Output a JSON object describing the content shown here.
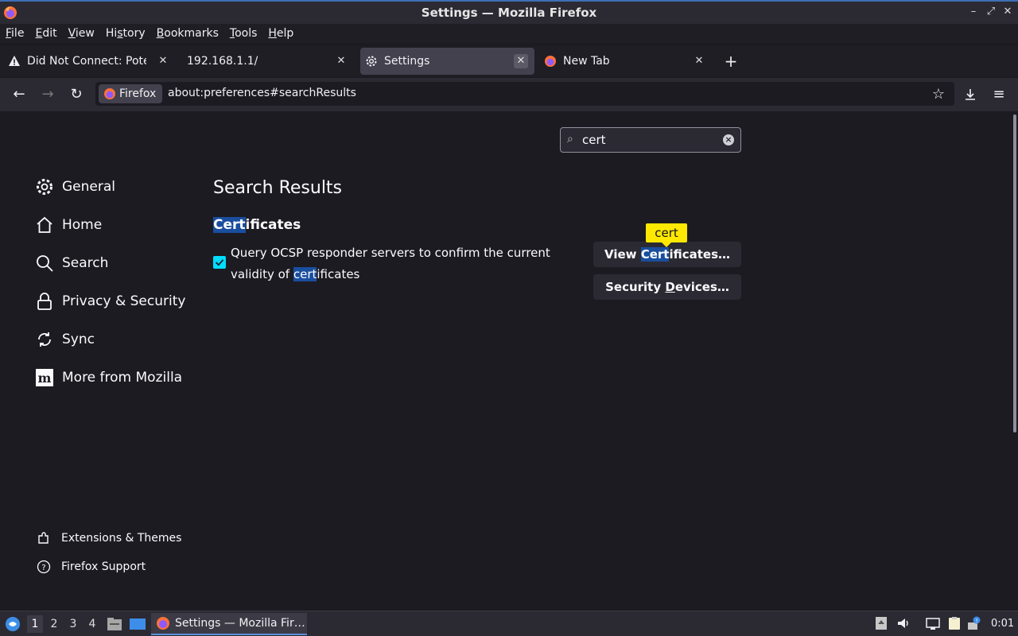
{
  "window": {
    "title": "Settings — Mozilla Firefox"
  },
  "menubar": [
    {
      "label": "File",
      "u": "F",
      "rest": "ile"
    },
    {
      "label": "Edit",
      "u": "E",
      "rest": "dit"
    },
    {
      "label": "View",
      "u": "V",
      "rest": "iew"
    },
    {
      "label": "History",
      "u": "H",
      "rest": "istory",
      "pre": "Hi",
      "mid": "s",
      "post": "tory"
    },
    {
      "label": "Bookmarks",
      "u": "B",
      "rest": "ookmarks"
    },
    {
      "label": "Tools",
      "u": "T",
      "rest": "ools"
    },
    {
      "label": "Help",
      "u": "H",
      "rest": "elp"
    }
  ],
  "tabs": [
    {
      "label": "Did Not Connect: Potenti",
      "icon": "warning-icon"
    },
    {
      "label": "192.168.1.1/",
      "icon": ""
    },
    {
      "label": "Settings",
      "icon": "gear-icon",
      "active": true
    },
    {
      "label": "New Tab",
      "icon": "firefox-icon"
    }
  ],
  "nav": {
    "identity_label": "Firefox",
    "url": "about:preferences#searchResults"
  },
  "search": {
    "value": "cert"
  },
  "sidebar": {
    "items": [
      {
        "label": "General",
        "icon": "gear-icon"
      },
      {
        "label": "Home",
        "icon": "home-icon"
      },
      {
        "label": "Search",
        "icon": "search-icon"
      },
      {
        "label": "Privacy & Security",
        "icon": "lock-icon"
      },
      {
        "label": "Sync",
        "icon": "sync-icon"
      },
      {
        "label": "More from Mozilla",
        "icon": "mozilla-icon"
      }
    ],
    "footer": [
      {
        "label": "Extensions & Themes",
        "icon": "puzzle-icon"
      },
      {
        "label": "Firefox Support",
        "icon": "help-icon"
      }
    ]
  },
  "main": {
    "results_title": "Search Results",
    "section_title_hl": "Cert",
    "section_title_rest": "ificates",
    "ocsp_line1": "Query OCSP responder servers to confirm the current",
    "ocsp_line2_pre": "validity of ",
    "ocsp_line2_hl": "cert",
    "ocsp_line2_post": "ificates",
    "ocsp_checked": true,
    "view_cert_pre": "View ",
    "view_cert_hl": "Cert",
    "view_cert_post": "ificates…",
    "security_devices_pre": "Security ",
    "security_devices_u": "D",
    "security_devices_post": "evices…",
    "tooltip": "cert"
  },
  "taskbar": {
    "workspaces": [
      "1",
      "2",
      "3",
      "4"
    ],
    "active_workspace": "1",
    "task_label": "Settings — Mozilla Fir…",
    "clock": "0:01"
  },
  "colors": {
    "accent": "#00ddff",
    "highlight": "#1a4e9e",
    "tooltip": "#ffe900",
    "background": "#1c1b22"
  }
}
